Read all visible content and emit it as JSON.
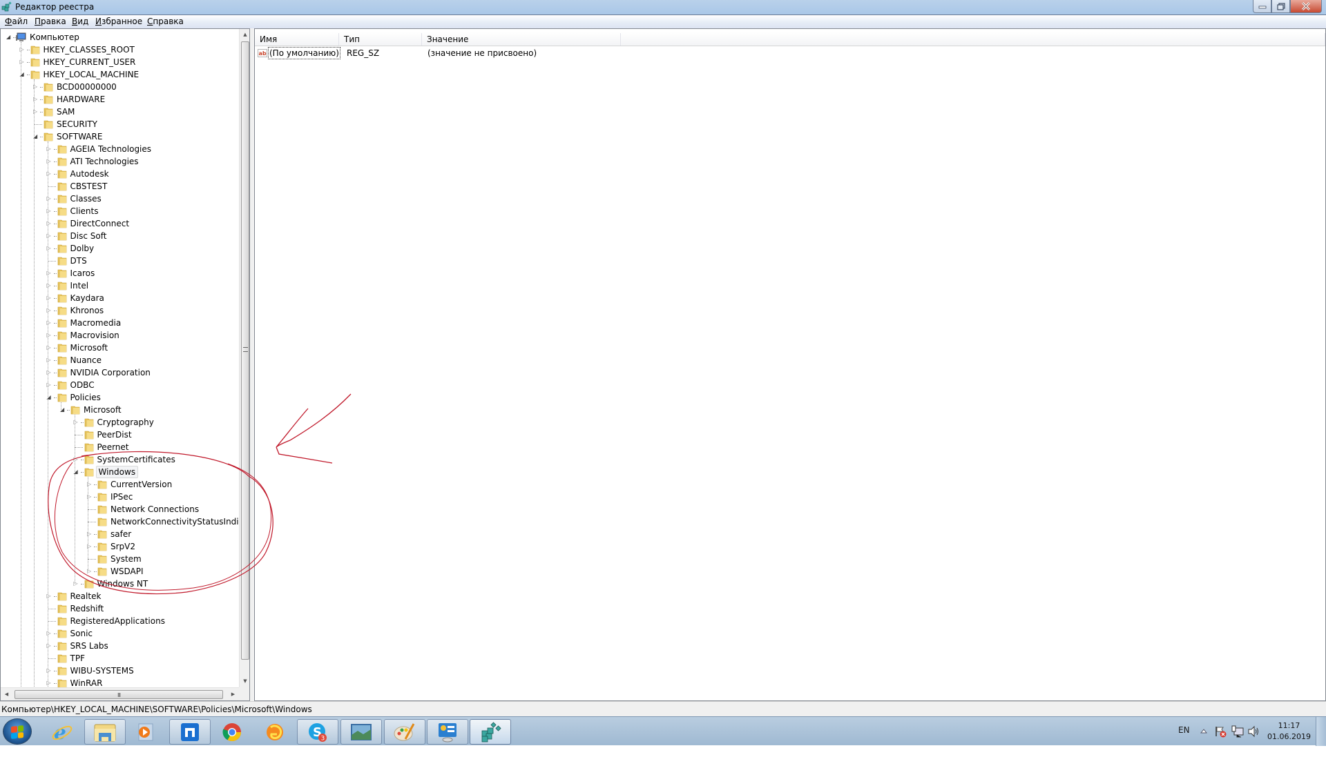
{
  "window": {
    "title": "Редактор реестра",
    "controls": {
      "minimize": "minimize",
      "maximize": "restore",
      "close": "close"
    }
  },
  "menu": [
    {
      "label": "Файл"
    },
    {
      "label": "Правка"
    },
    {
      "label": "Вид"
    },
    {
      "label": "Избранное"
    },
    {
      "label": "Справка"
    }
  ],
  "tree": {
    "root": "Компьютер",
    "rows": [
      {
        "label": "Компьютер",
        "level": 0,
        "state": "open",
        "icon": "computer-icon"
      },
      {
        "label": "HKEY_CLASSES_ROOT",
        "level": 1,
        "state": "closed"
      },
      {
        "label": "HKEY_CURRENT_USER",
        "level": 1,
        "state": "closed"
      },
      {
        "label": "HKEY_LOCAL_MACHINE",
        "level": 1,
        "state": "open"
      },
      {
        "label": "BCD00000000",
        "level": 2,
        "state": "closed"
      },
      {
        "label": "HARDWARE",
        "level": 2,
        "state": "closed"
      },
      {
        "label": "SAM",
        "level": 2,
        "state": "closed"
      },
      {
        "label": "SECURITY",
        "level": 2,
        "state": "leaf"
      },
      {
        "label": "SOFTWARE",
        "level": 2,
        "state": "open"
      },
      {
        "label": "AGEIA Technologies",
        "level": 3,
        "state": "closed"
      },
      {
        "label": "ATI Technologies",
        "level": 3,
        "state": "closed"
      },
      {
        "label": "Autodesk",
        "level": 3,
        "state": "closed"
      },
      {
        "label": "CBSTEST",
        "level": 3,
        "state": "leaf"
      },
      {
        "label": "Classes",
        "level": 3,
        "state": "closed"
      },
      {
        "label": "Clients",
        "level": 3,
        "state": "closed"
      },
      {
        "label": "DirectConnect",
        "level": 3,
        "state": "closed"
      },
      {
        "label": "Disc Soft",
        "level": 3,
        "state": "closed"
      },
      {
        "label": "Dolby",
        "level": 3,
        "state": "closed"
      },
      {
        "label": "DTS",
        "level": 3,
        "state": "leaf"
      },
      {
        "label": "Icaros",
        "level": 3,
        "state": "closed"
      },
      {
        "label": "Intel",
        "level": 3,
        "state": "closed"
      },
      {
        "label": "Kaydara",
        "level": 3,
        "state": "closed"
      },
      {
        "label": "Khronos",
        "level": 3,
        "state": "closed"
      },
      {
        "label": "Macromedia",
        "level": 3,
        "state": "closed"
      },
      {
        "label": "Macrovision",
        "level": 3,
        "state": "closed"
      },
      {
        "label": "Microsoft",
        "level": 3,
        "state": "closed"
      },
      {
        "label": "Nuance",
        "level": 3,
        "state": "closed"
      },
      {
        "label": "NVIDIA Corporation",
        "level": 3,
        "state": "closed"
      },
      {
        "label": "ODBC",
        "level": 3,
        "state": "closed"
      },
      {
        "label": "Policies",
        "level": 3,
        "state": "open"
      },
      {
        "label": "Microsoft",
        "level": 4,
        "state": "open"
      },
      {
        "label": "Cryptography",
        "level": 5,
        "state": "closed"
      },
      {
        "label": "PeerDist",
        "level": 5,
        "state": "leaf"
      },
      {
        "label": "Peernet",
        "level": 5,
        "state": "leaf"
      },
      {
        "label": "SystemCertificates",
        "level": 5,
        "state": "closed"
      },
      {
        "label": "Windows",
        "level": 5,
        "state": "open",
        "selected": true
      },
      {
        "label": "CurrentVersion",
        "level": 6,
        "state": "closed"
      },
      {
        "label": "IPSec",
        "level": 6,
        "state": "closed"
      },
      {
        "label": "Network Connections",
        "level": 6,
        "state": "leaf"
      },
      {
        "label": "NetworkConnectivityStatusIndicato",
        "level": 6,
        "state": "leaf"
      },
      {
        "label": "safer",
        "level": 6,
        "state": "closed"
      },
      {
        "label": "SrpV2",
        "level": 6,
        "state": "closed"
      },
      {
        "label": "System",
        "level": 6,
        "state": "leaf"
      },
      {
        "label": "WSDAPI",
        "level": 6,
        "state": "closed"
      },
      {
        "label": "Windows NT",
        "level": 5,
        "state": "closed"
      },
      {
        "label": "Realtek",
        "level": 3,
        "state": "closed"
      },
      {
        "label": "Redshift",
        "level": 3,
        "state": "leaf"
      },
      {
        "label": "RegisteredApplications",
        "level": 3,
        "state": "leaf"
      },
      {
        "label": "Sonic",
        "level": 3,
        "state": "closed"
      },
      {
        "label": "SRS Labs",
        "level": 3,
        "state": "closed"
      },
      {
        "label": "TPF",
        "level": 3,
        "state": "leaf"
      },
      {
        "label": "WIBU-SYSTEMS",
        "level": 3,
        "state": "closed"
      },
      {
        "label": "WinRAR",
        "level": 3,
        "state": "closed"
      }
    ],
    "hscroll_grip": "III"
  },
  "list": {
    "columns": [
      {
        "label": "Имя"
      },
      {
        "label": "Тип"
      },
      {
        "label": "Значение"
      }
    ],
    "rows": [
      {
        "icon": "ab",
        "name": "(По умолчанию)",
        "type": "REG_SZ",
        "value": "(значение не присвоено)"
      }
    ]
  },
  "status": {
    "path": "Компьютер\\HKEY_LOCAL_MACHINE\\SOFTWARE\\Policies\\Microsoft\\Windows"
  },
  "taskbar": {
    "apps": [
      {
        "name": "internet-explorer",
        "state": "pinned"
      },
      {
        "name": "windows-explorer",
        "state": "running"
      },
      {
        "name": "media-player",
        "state": "pinned"
      },
      {
        "name": "maxthon",
        "state": "running"
      },
      {
        "name": "chrome",
        "state": "pinned"
      },
      {
        "name": "firefox-like-browser",
        "state": "pinned"
      },
      {
        "name": "skype",
        "state": "running",
        "badge": "3"
      },
      {
        "name": "photo-viewer",
        "state": "running"
      },
      {
        "name": "paint",
        "state": "running"
      },
      {
        "name": "control-panel",
        "state": "running"
      },
      {
        "name": "registry-editor",
        "state": "active"
      }
    ],
    "tray": {
      "language": "EN",
      "time": "11:17",
      "date": "01.06.2019"
    }
  },
  "colors": {
    "annotation": "#c0182a",
    "selection_bg": "#f3f4f6",
    "titlebar": "#b9d1ea",
    "taskbar": "#a9c2da"
  }
}
